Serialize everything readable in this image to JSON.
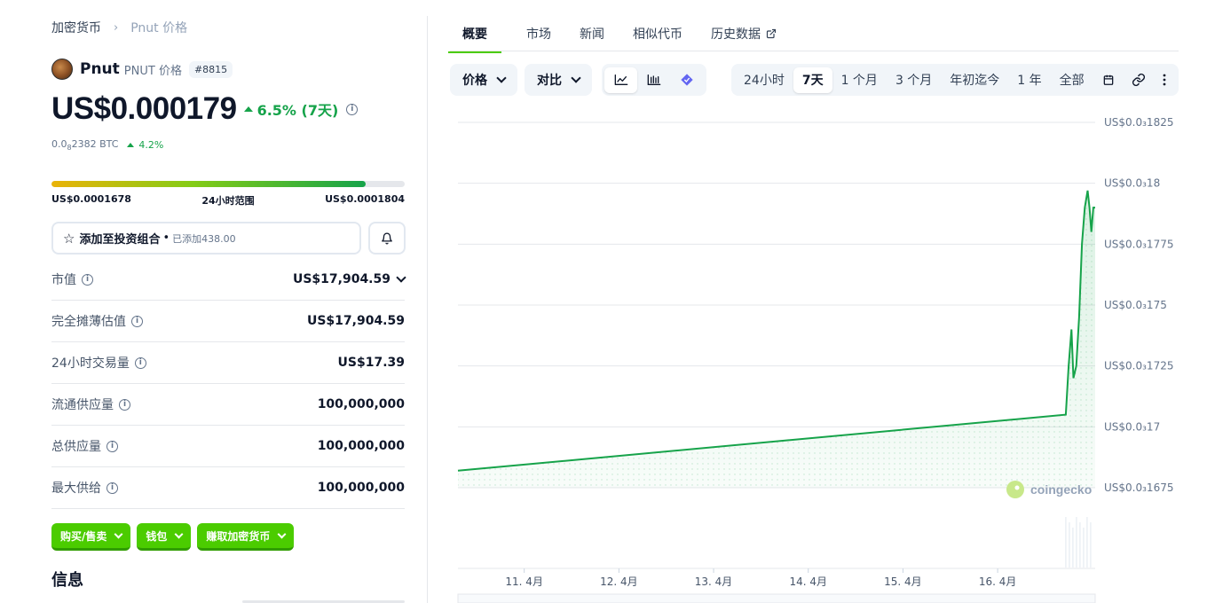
{
  "breadcrumb": {
    "root": "加密货币",
    "current": "Pnut 价格"
  },
  "coin": {
    "name": "Pnut",
    "symbol_label": "PNUT 价格",
    "rank": "#8815"
  },
  "price": {
    "value": "US$0.000179",
    "change": "6.5% (7天)",
    "btc_prefix": "0.0",
    "btc_sub": "8",
    "btc_rest": "2382 BTC",
    "btc_change": "4.2%"
  },
  "range_24h": {
    "low": "US$0.0001678",
    "label": "24小时范围",
    "high": "US$0.0001804",
    "position_percent": 89
  },
  "portfolio": {
    "label": "添加至投资组合",
    "added": "已添加438.00"
  },
  "stats": [
    {
      "label": "市值",
      "value": "US$17,904.59",
      "expandable": true
    },
    {
      "label": "完全摊薄估值",
      "value": "US$17,904.59"
    },
    {
      "label": "24小时交易量",
      "value": "US$17.39"
    },
    {
      "label": "流通供应量",
      "value": "100,000,000"
    },
    {
      "label": "总供应量",
      "value": "100,000,000"
    },
    {
      "label": "最大供给",
      "value": "100,000,000"
    }
  ],
  "actions": {
    "buy_sell": "购买/售卖",
    "wallet": "钱包",
    "earn": "赚取加密货币"
  },
  "info_title": "信息",
  "tabs": [
    "概要",
    "市场",
    "新闻",
    "相似代币",
    "历史数据"
  ],
  "toolbar": {
    "price": "价格",
    "compare": "对比"
  },
  "ranges": [
    "24小时",
    "7天",
    "1 个月",
    "3 个月",
    "年初迄今",
    "1 年",
    "全部"
  ],
  "active_range": "7天",
  "watermark": "coingecko",
  "colors": {
    "accent": "#4bcc00",
    "line": "#16a34a",
    "up": "#16a34a"
  },
  "chart_data": {
    "type": "area",
    "y_tick_labels": [
      "US$0.0₃1825",
      "US$0.0₃18",
      "US$0.0₃1775",
      "US$0.0₃175",
      "US$0.0₃1725",
      "US$0.0₃17",
      "US$0.0₃1675"
    ],
    "y_ticks": [
      0.0001825,
      0.00018,
      0.0001775,
      0.000175,
      0.0001725,
      0.00017,
      0.0001675
    ],
    "ylim": [
      0.0001675,
      0.0001825
    ],
    "x_ticks": [
      11,
      12,
      13,
      14,
      15,
      16
    ],
    "x_tick_labels": [
      "11. 4月",
      "12. 4月",
      "13. 4月",
      "14. 4月",
      "15. 4月",
      "16. 4月"
    ],
    "xlim": [
      10.3,
      17.03
    ],
    "x": [
      10.3,
      16.72,
      16.75,
      16.78,
      16.8,
      16.83,
      16.86,
      16.89,
      16.92,
      16.95,
      16.97,
      16.99,
      17.01,
      17.03
    ],
    "y": [
      0.0001682,
      0.0001705,
      0.0001725,
      0.000174,
      0.000172,
      0.0001725,
      0.0001745,
      0.0001775,
      0.000179,
      0.0001797,
      0.000179,
      0.000178,
      0.000179,
      0.000179
    ],
    "grid": true
  }
}
